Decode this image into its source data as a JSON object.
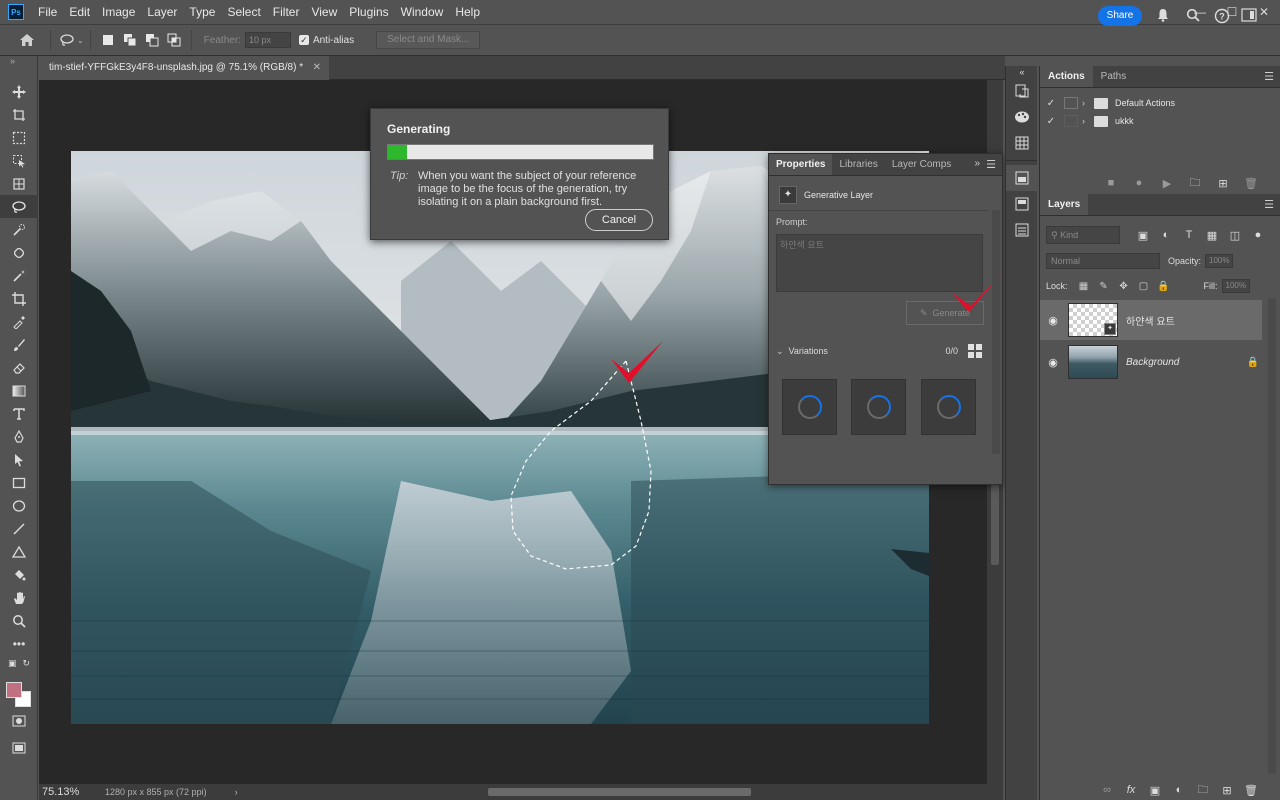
{
  "app": {
    "logo_text": "Ps"
  },
  "menu": [
    "File",
    "Edit",
    "Image",
    "Layer",
    "Type",
    "Select",
    "Filter",
    "View",
    "Plugins",
    "Window",
    "Help"
  ],
  "options_bar": {
    "feather_label": "Feather:",
    "feather_value": "10 px",
    "antialias_label": "Anti-alias",
    "antialias_checked": true,
    "select_mask_label": "Select and Mask...",
    "share_label": "Share"
  },
  "document": {
    "tab_title": "tim-stief-YFFGkE3y4F8-unsplash.jpg @ 75.1% (RGB/8) *",
    "zoom": "75.13%",
    "info": "1280 px x 855 px (72 ppi)"
  },
  "generating_dialog": {
    "title": "Generating",
    "progress_fraction": 0.07,
    "tip_label": "Tip:",
    "tip_text": "When you want the subject of your reference image to be the focus of the generation, try isolating it on a plain background first.",
    "cancel_label": "Cancel"
  },
  "properties_panel": {
    "tabs": [
      "Properties",
      "Libraries",
      "Layer Comps"
    ],
    "active_tab": 0,
    "layer_type_label": "Generative Layer",
    "prompt_label": "Prompt:",
    "prompt_value": "하얀색 요트",
    "generate_label": "Generate",
    "variations_label": "Variations",
    "variations_count": "0/0"
  },
  "actions_panel": {
    "tabs": [
      "Actions",
      "Paths"
    ],
    "active_tab": 0,
    "items": [
      {
        "label": "Default Actions",
        "checked": true
      },
      {
        "label": "ukkk",
        "checked": true
      }
    ]
  },
  "layers_panel": {
    "tab": "Layers",
    "kind_label": "Kind",
    "blend_mode": "Normal",
    "opacity_label": "Opacity:",
    "opacity_value": "100%",
    "lock_label": "Lock:",
    "fill_label": "Fill:",
    "fill_value": "100%",
    "layers": [
      {
        "name": "하얀색 요트",
        "visible": true,
        "selected": true,
        "type": "generative"
      },
      {
        "name": "Background",
        "visible": true,
        "selected": false,
        "type": "background",
        "locked": true
      }
    ]
  },
  "colors": {
    "accent": "#1473e6",
    "progress": "#2db82d",
    "foreground_swatch": "#c07080",
    "background_swatch": "#ffffff",
    "annotation_check": "#e0102a"
  },
  "icons": {
    "toolbar": [
      "move-icon",
      "artboard-icon",
      "marquee-icon",
      "object-select-icon",
      "crop-frame-icon",
      "lasso-icon",
      "quick-select-icon",
      "spot-heal-icon",
      "magic-wand-icon",
      "crop-icon",
      "eyedropper-icon",
      "brush-icon",
      "eraser-icon",
      "gradient-icon",
      "type-icon",
      "pen-icon",
      "path-select-icon",
      "rectangle-icon",
      "ellipse-icon",
      "line-icon",
      "triangle-icon",
      "paint-bucket-icon",
      "hand-icon",
      "zoom-icon",
      "more-tools-icon"
    ]
  }
}
